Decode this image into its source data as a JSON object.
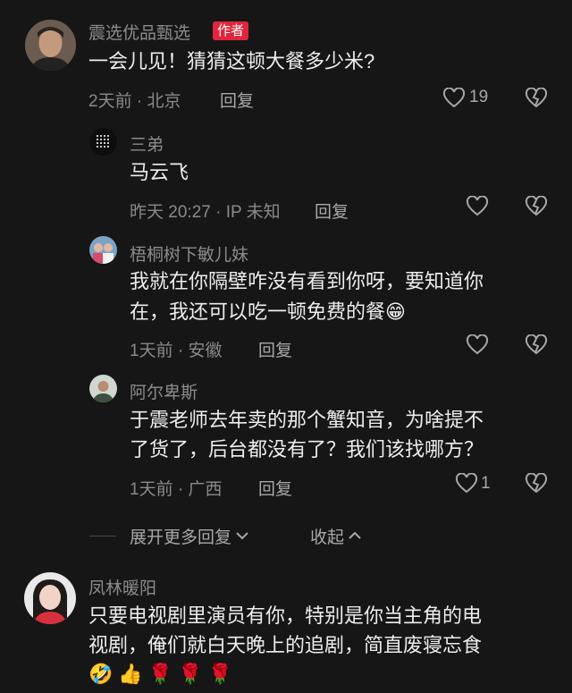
{
  "comments": [
    {
      "author": "震选优品甄选",
      "badge": "作者",
      "text": "一会儿见！猜猜这顿大餐多少米?",
      "meta": "2天前 · 北京",
      "reply": "回复",
      "likes": "19",
      "replies": [
        {
          "author": "三弟",
          "text": "马云飞",
          "meta": "昨天 20:27 · IP 未知",
          "reply": "回复",
          "likes": ""
        },
        {
          "author": "梧桐树下敏儿妹",
          "text_line1": "我就在你隔壁咋没有看到你呀，要知道你",
          "text_line2": "在，我还可以吃一顿免费的餐",
          "emoji": "😁",
          "meta": "1天前 · 安徽",
          "reply": "回复",
          "likes": ""
        },
        {
          "author": "阿尔卑斯",
          "text_line1": "于震老师去年卖的那个蟹知音，为啥提不",
          "text_line2": "了货了，后台都没有了？我们该找哪方？",
          "meta": "1天前 · 广西",
          "reply": "回复",
          "likes": "1"
        }
      ],
      "expand_label": "展开更多回复",
      "collapse_label": "收起"
    },
    {
      "author": "凤林暖阳",
      "text_line1": "只要电视剧里演员有你，特别是你当主角的电",
      "text_line2": "视剧，俺们就白天晚上的追剧，简直废寝忘食",
      "emojis": "🤣👍🌹🌹🌹"
    }
  ],
  "icons": {
    "like": "heart-outline-icon",
    "dislike": "broken-heart-icon",
    "expand": "chevron-down-icon",
    "collapse": "chevron-up-icon"
  }
}
